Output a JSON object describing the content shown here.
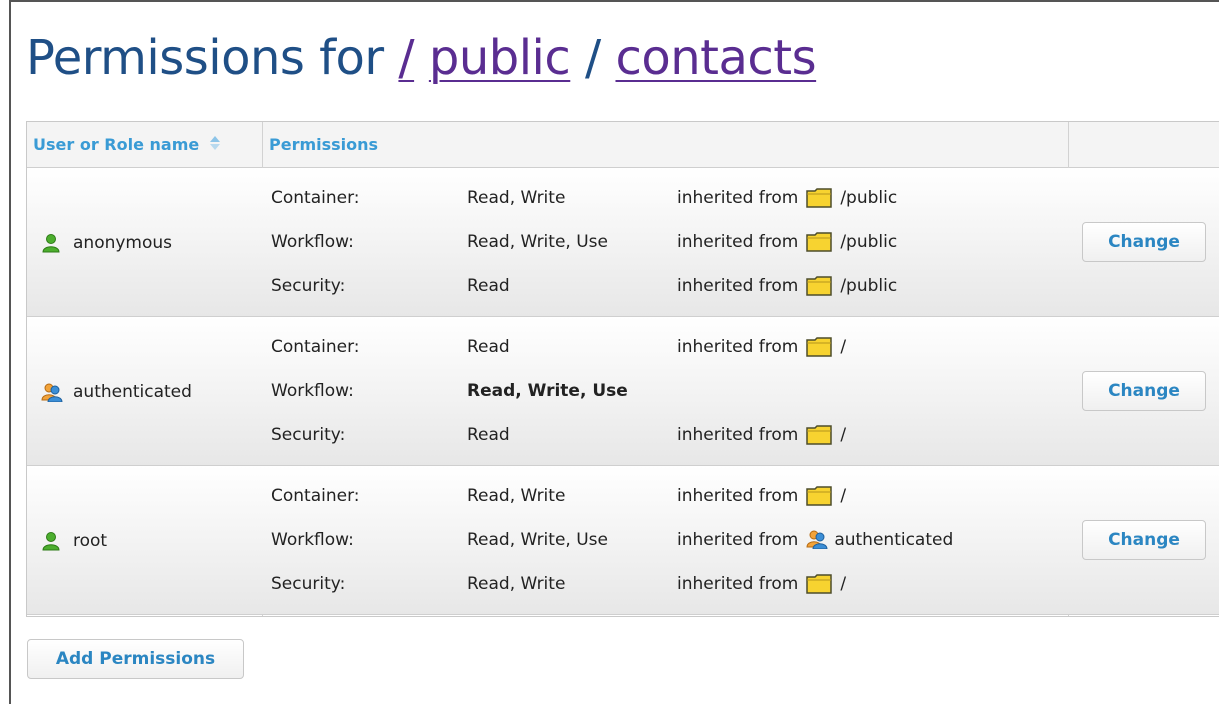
{
  "header": {
    "title_prefix": "Permissions for",
    "breadcrumb_root": "/",
    "breadcrumb_public": "public",
    "breadcrumb_sep": "/",
    "breadcrumb_contacts": "contacts"
  },
  "table": {
    "col_user": "User or Role name",
    "col_sort_icon": "sort-icon",
    "col_permissions": "Permissions",
    "rows": [
      {
        "name": "anonymous",
        "icon": "user-green-icon",
        "perms": [
          {
            "key": "Container:",
            "value": "Read, Write",
            "inherited_label": "inherited from",
            "inherited_from": "/public",
            "inherited_type": "folder"
          },
          {
            "key": "Workflow:",
            "value": "Read, Write, Use",
            "inherited_label": "inherited from",
            "inherited_from": "/public",
            "inherited_type": "folder"
          },
          {
            "key": "Security:",
            "value": "Read",
            "inherited_label": "inherited from",
            "inherited_from": "/public",
            "inherited_type": "folder"
          }
        ],
        "button": "Change"
      },
      {
        "name": "authenticated",
        "icon": "group-icon",
        "perms": [
          {
            "key": "Container:",
            "value": "Read",
            "inherited_label": "inherited from",
            "inherited_from": "/",
            "inherited_type": "folder"
          },
          {
            "key": "Workflow:",
            "value": "Read, Write, Use",
            "inherited_label": "",
            "inherited_from": "",
            "inherited_type": "none"
          },
          {
            "key": "Security:",
            "value": "Read",
            "inherited_label": "inherited from",
            "inherited_from": "/",
            "inherited_type": "folder"
          }
        ],
        "button": "Change"
      },
      {
        "name": "root",
        "icon": "user-green-icon",
        "perms": [
          {
            "key": "Container:",
            "value": "Read, Write",
            "inherited_label": "inherited from",
            "inherited_from": "/",
            "inherited_type": "folder"
          },
          {
            "key": "Workflow:",
            "value": "Read, Write, Use",
            "inherited_label": "inherited from",
            "inherited_from": "authenticated",
            "inherited_type": "role"
          },
          {
            "key": "Security:",
            "value": "Read, Write",
            "inherited_label": "inherited from",
            "inherited_from": "/",
            "inherited_type": "folder"
          }
        ],
        "button": "Change"
      }
    ]
  },
  "actions": {
    "add_permissions": "Add Permissions"
  },
  "colors": {
    "title": "#1f4f86",
    "link": "#5a2d91",
    "accent": "#3a9bd5",
    "folder": "#f7d330"
  }
}
